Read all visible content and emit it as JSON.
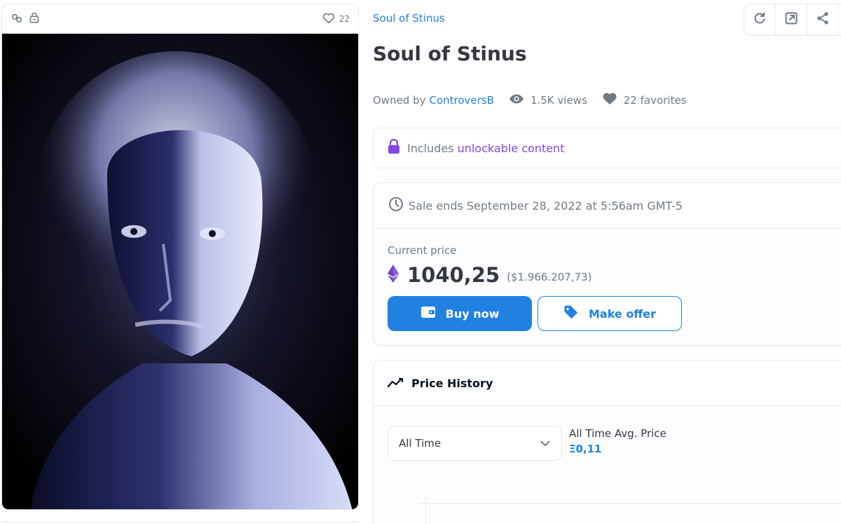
{
  "media": {
    "like_count": "22",
    "icons": [
      "link-icon",
      "lock-icon",
      "heart-outline-icon"
    ]
  },
  "collection": {
    "name": "Soul of Stinus"
  },
  "item": {
    "title": "Soul of Stinus"
  },
  "meta": {
    "owned_by_label": "Owned by",
    "owner": "ControversB",
    "views": "1.5K views",
    "favorites": "22 favorites"
  },
  "unlockable": {
    "prefix": "Includes",
    "link": "unlockable content"
  },
  "sale": {
    "ends_text": "Sale ends September 28, 2022 at 5:56am GMT-5",
    "current_price_label": "Current price",
    "price": "1040,25",
    "price_fiat": "($1.966.207,73)",
    "buy_label": "Buy now",
    "offer_label": "Make offer"
  },
  "history": {
    "title": "Price History",
    "range": "All Time",
    "avg_label": "All Time Avg. Price",
    "avg_value": "Ξ0,11"
  },
  "colors": {
    "accent": "#2081e2",
    "purple": "#8247e5",
    "text": "#353840",
    "muted": "#707a83",
    "border": "#e5e8eb"
  }
}
